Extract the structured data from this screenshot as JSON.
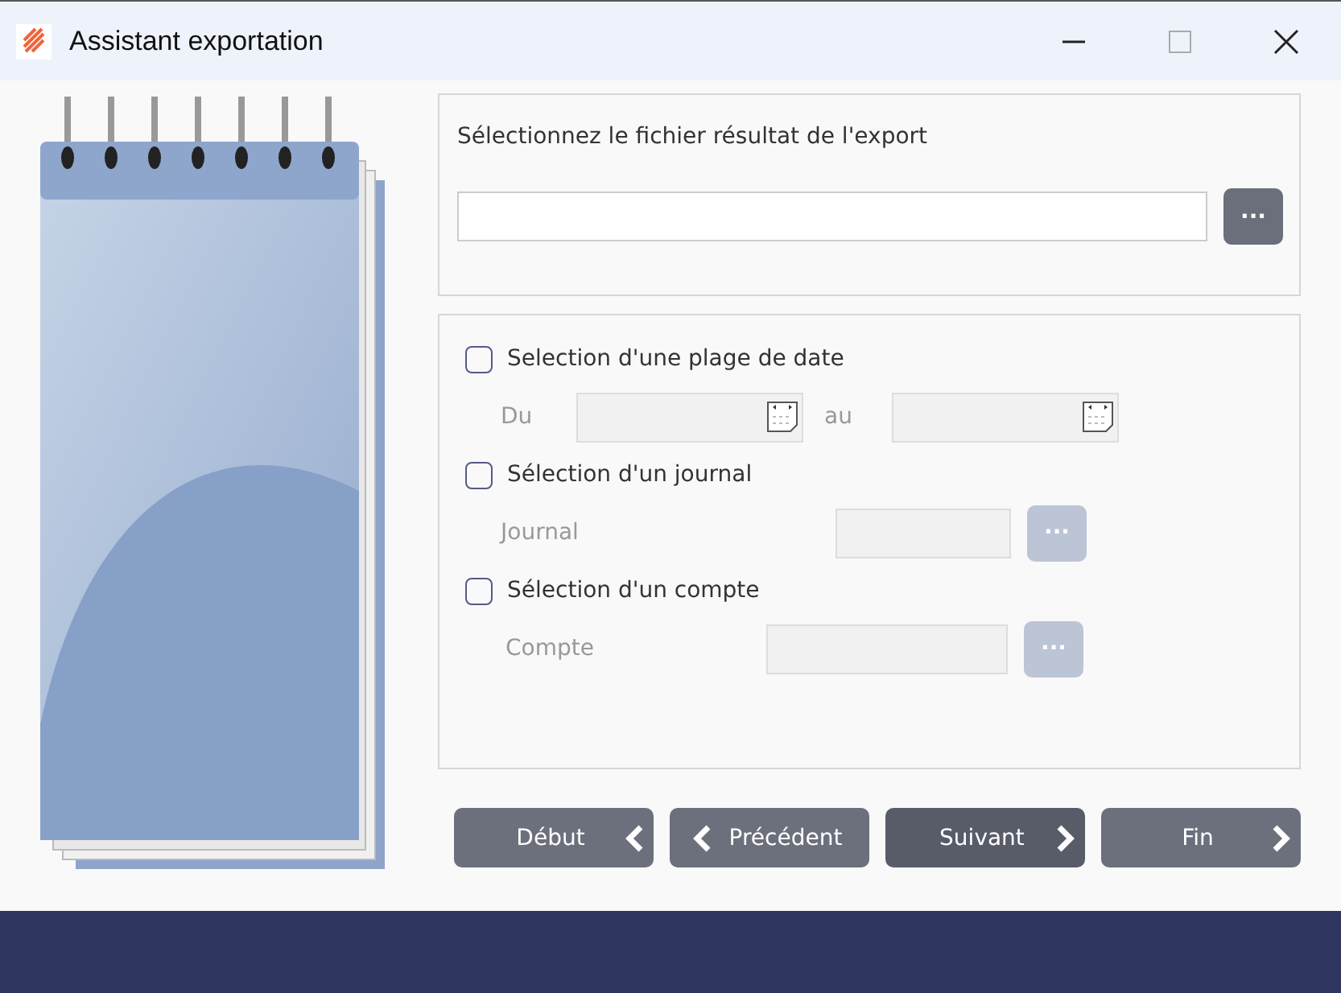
{
  "window": {
    "title": "Assistant exportation"
  },
  "file_panel": {
    "prompt": "Sélectionnez le fichier résultat de l'export",
    "browse_button": {
      "label": "···",
      "disabled": false
    }
  },
  "filters": [
    {
      "label": "Selection d'une plage de date",
      "checked": false,
      "kind": "daterange",
      "from_label": "Du",
      "to_label": "au",
      "disabled": true
    },
    {
      "label": "Sélection d'un journal",
      "checked": false,
      "kind": "lookup",
      "field_label": "Journal",
      "browse_label": "···",
      "disabled": true
    },
    {
      "label": "Sélection d'un compte",
      "checked": false,
      "kind": "lookup",
      "field_label": "Compte",
      "browse_label": "···",
      "disabled": true
    }
  ],
  "buttons": [
    {
      "label": "Début",
      "kind": "first",
      "selected": false
    },
    {
      "label": "Précédent",
      "kind": "previous",
      "selected": false
    },
    {
      "label": "Suivant",
      "kind": "next",
      "selected": true
    },
    {
      "label": "Fin",
      "kind": "last",
      "selected": false
    }
  ]
}
